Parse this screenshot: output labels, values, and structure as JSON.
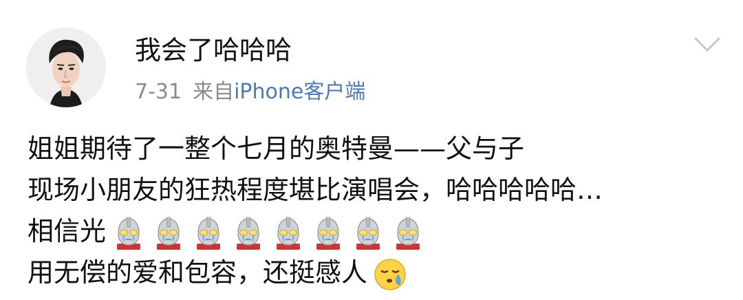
{
  "post": {
    "username": "我会了哈哈哈",
    "date": "7-31",
    "source_prefix": "来自",
    "source_client": "iPhone客户端",
    "avatar_icon": "user-avatar-photo",
    "menu_icon": "chevron-down-icon",
    "content": {
      "line1": "姐姐期待了一整个七月的奥特曼——父与子",
      "line2": "现场小朋友的狂热程度堪比演唱会，哈哈哈哈哈…",
      "line3_text": "相信光",
      "line3_emoji_count": 8,
      "line3_emoji_icon": "ultraman-emoji-icon",
      "line4_text": "用无偿的爱和包容，还挺感人",
      "line4_emoji_icon": "tearful-face-emoji-icon"
    }
  },
  "colors": {
    "text": "#111111",
    "meta_gray": "#8a8a8a",
    "link_blue": "#4d79b7",
    "chevron": "#c7c7c7"
  }
}
